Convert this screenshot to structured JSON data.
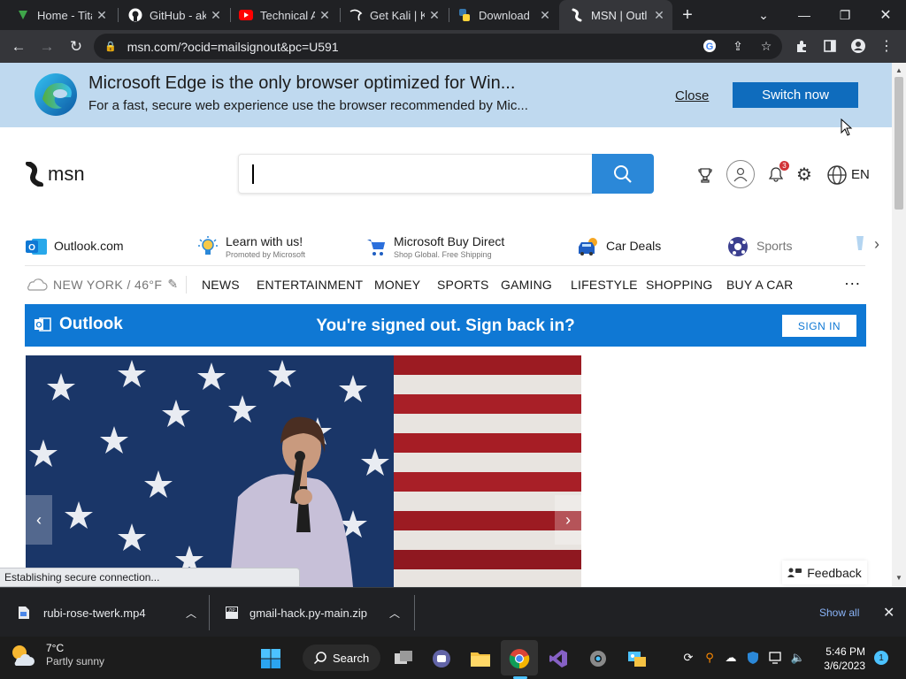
{
  "browser": {
    "tabs": [
      {
        "title": "Home - Tita",
        "icon": "titan-icon",
        "active": false
      },
      {
        "title": "GitHub - ak",
        "icon": "github-icon",
        "active": false
      },
      {
        "title": "Technical A",
        "icon": "youtube-icon",
        "active": false
      },
      {
        "title": "Get Kali | K",
        "icon": "kali-icon",
        "active": false
      },
      {
        "title": "Download",
        "icon": "python-icon",
        "active": false
      },
      {
        "title": "MSN | Outl",
        "icon": "msn-icon",
        "active": true
      }
    ],
    "new_tab_label": "+",
    "url": "msn.com/?ocid=mailsignout&pc=U591",
    "status_text": "Establishing secure connection..."
  },
  "edge_banner": {
    "title": "Microsoft Edge is the only browser optimized for Win...",
    "subtitle": "For a fast, secure web experience use the browser recommended by Mic...",
    "close_label": "Close",
    "switch_label": "Switch now"
  },
  "msn": {
    "logo_text": "msn",
    "search_placeholder": "",
    "notification_count": "3",
    "language": "EN",
    "quick_links": [
      {
        "label": "Outlook.com",
        "sub": "",
        "icon": "outlook-icon"
      },
      {
        "label": "Learn with us!",
        "sub": "Promoted by Microsoft",
        "icon": "lightbulb-icon"
      },
      {
        "label": "Microsoft Buy Direct",
        "sub": "Shop Global. Free Shipping",
        "icon": "cart-icon"
      },
      {
        "label": "Car Deals",
        "sub": "",
        "icon": "car-icon"
      },
      {
        "label": "Sports",
        "sub": "",
        "icon": "sports-icon"
      }
    ],
    "weather": "NEW YORK / 46°F",
    "nav": [
      "NEWS",
      "ENTERTAINMENT",
      "MONEY",
      "SPORTS",
      "GAMING",
      "LIFESTYLE",
      "SHOPPING",
      "BUY A CAR"
    ],
    "more_label": "···",
    "outlook_bar": {
      "brand": "Outlook",
      "message": "You're signed out. Sign back in?",
      "signin_label": "SIGN IN"
    },
    "feedback_label": "Feedback"
  },
  "downloads": {
    "items": [
      {
        "name": "rubi-rose-twerk.mp4"
      },
      {
        "name": "gmail-hack.py-main.zip"
      }
    ],
    "show_all_label": "Show all"
  },
  "taskbar": {
    "weather_temp": "7°C",
    "weather_desc": "Partly sunny",
    "search_label": "Search",
    "time": "5:46 PM",
    "date": "3/6/2023",
    "notification_badge": "1"
  },
  "colors": {
    "edge_banner_bg": "#bfd9ef",
    "switch_button": "#0f6cbd",
    "outlook_blue": "#0f78d4",
    "search_button": "#2b88d8",
    "chrome_dark": "#202124"
  }
}
